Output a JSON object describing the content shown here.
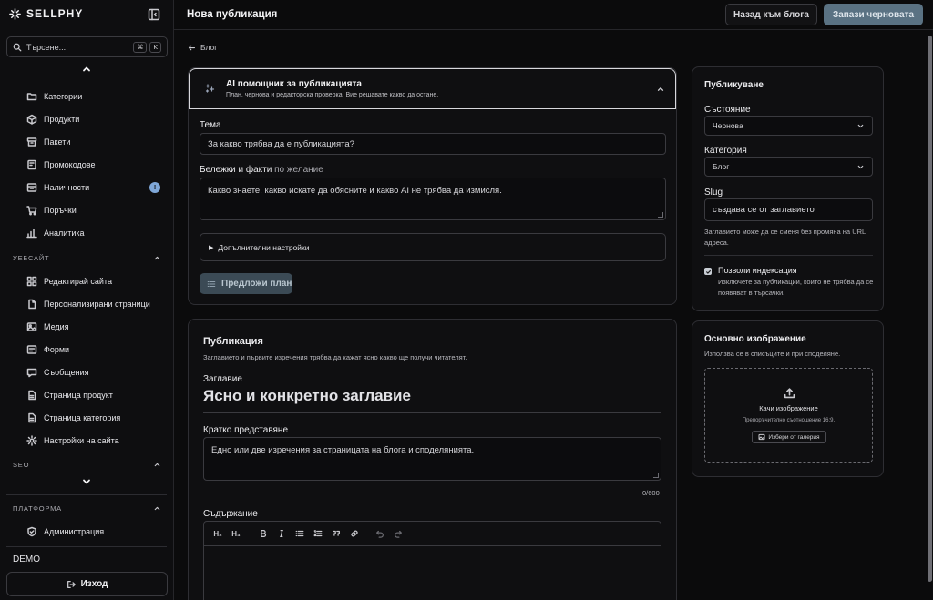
{
  "brand": {
    "name": "SELLPHY"
  },
  "search": {
    "placeholder": "Търсене...",
    "kbd_mod": "⌘",
    "kbd_key": "K"
  },
  "nav": {
    "catalog": [
      {
        "label": "Категории",
        "icon": "folder-icon"
      },
      {
        "label": "Продукти",
        "icon": "box-icon"
      },
      {
        "label": "Пакети",
        "icon": "package-icon"
      },
      {
        "label": "Промокодове",
        "icon": "tag-icon"
      },
      {
        "label": "Наличности",
        "icon": "inventory-icon",
        "badge": "!"
      },
      {
        "label": "Поръчки",
        "icon": "cart-icon"
      },
      {
        "label": "Аналитика",
        "icon": "chart-icon"
      }
    ],
    "website_heading": "УЕБСАЙТ",
    "website": [
      {
        "label": "Редактирай сайта",
        "icon": "grid-icon"
      },
      {
        "label": "Персонализирани страници",
        "icon": "file-icon"
      },
      {
        "label": "Медия",
        "icon": "image-icon"
      },
      {
        "label": "Форми",
        "icon": "form-icon"
      },
      {
        "label": "Съобщения",
        "icon": "message-icon"
      },
      {
        "label": "Страница продукт",
        "icon": "page-icon"
      },
      {
        "label": "Страница категория",
        "icon": "page-icon"
      },
      {
        "label": "Настройки на сайта",
        "icon": "gear-icon"
      }
    ],
    "seo_heading": "SEO",
    "platform_heading": "ПЛАТФОРМА",
    "platform": [
      {
        "label": "Администрация",
        "icon": "shield-icon"
      }
    ]
  },
  "footer": {
    "env": "DEMO",
    "logout": "Изход"
  },
  "header": {
    "title": "Нова публикация",
    "back_button": "Назад към блога",
    "save_button": "Запази черновата"
  },
  "breadcrumb": {
    "label": "Блог"
  },
  "ai": {
    "title": "AI помощник за публикацията",
    "subtitle": "План, чернова и редакторска проверка. Вие решавате какво да остане.",
    "topic_label": "Тема",
    "topic_placeholder": "За какво трябва да е публикацията?",
    "notes_label": "Бележки и факти",
    "notes_optional": "по желание",
    "notes_placeholder": "Какво знаете, какво искате да обясните и какво AI не трябва да измисля.",
    "advanced": "Допълнителни настройки",
    "plan_button": "Предложи план"
  },
  "publication": {
    "heading": "Публикация",
    "subheading": "Заглавието и първите изречения трябва да кажат ясно какво ще получи читателят.",
    "title_label": "Заглавие",
    "title_placeholder": "Ясно и конкретно заглавие",
    "excerpt_label": "Кратко представяне",
    "excerpt_placeholder": "Едно или две изречения за страницата на блога и споделянията.",
    "excerpt_counter": "0/600",
    "content_label": "Съдържание",
    "toolbar": [
      "H₂",
      "H₃"
    ]
  },
  "publish": {
    "heading": "Публикуване",
    "status_label": "Състояние",
    "status_value": "Чернова",
    "category_label": "Категория",
    "category_value": "Блог",
    "slug_label": "Slug",
    "slug_placeholder": "създава се от заглавието",
    "slug_help": "Заглавието може да се сменя без промяна на URL адреса.",
    "index_label": "Позволи индексация",
    "index_help": "Изключете за публикации, които не трябва да се появяват в търсачки.",
    "index_checked": true
  },
  "image": {
    "heading": "Основно изображение",
    "subheading": "Използва се в списъците и при споделяне.",
    "upload": "Качи изображение",
    "ratio": "Препоръчително съотношение 16:9.",
    "gallery": "Избери от галерия"
  }
}
